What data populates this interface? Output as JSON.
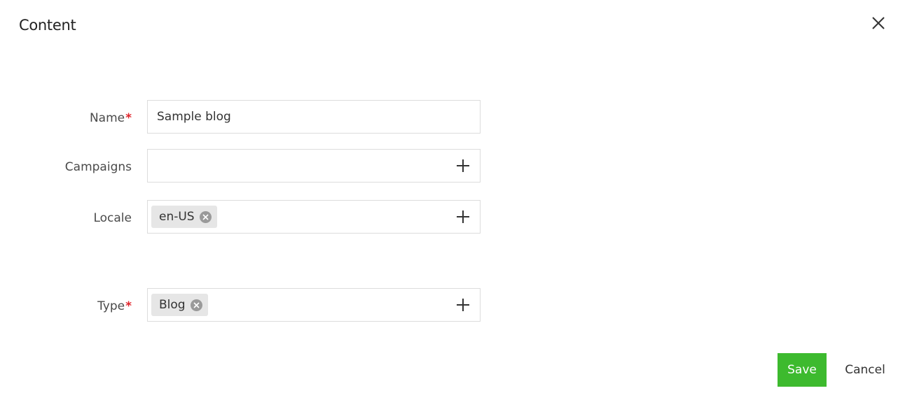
{
  "dialog": {
    "title": "Content",
    "close_icon": "close-icon"
  },
  "form": {
    "name": {
      "label": "Name",
      "required": "*",
      "value": "Sample blog"
    },
    "campaigns": {
      "label": "Campaigns",
      "add_icon": "plus-icon"
    },
    "locale": {
      "label": "Locale",
      "tags": [
        "en-US"
      ],
      "add_icon": "plus-icon"
    },
    "type": {
      "label": "Type",
      "required": "*",
      "tags": [
        "Blog"
      ],
      "add_icon": "plus-icon"
    }
  },
  "actions": {
    "save_label": "Save",
    "cancel_label": "Cancel"
  },
  "colors": {
    "save_bg": "#3dba2e",
    "required_star": "#e0242b",
    "tag_bg": "#e6e6e6",
    "border": "#dcdcdc"
  }
}
